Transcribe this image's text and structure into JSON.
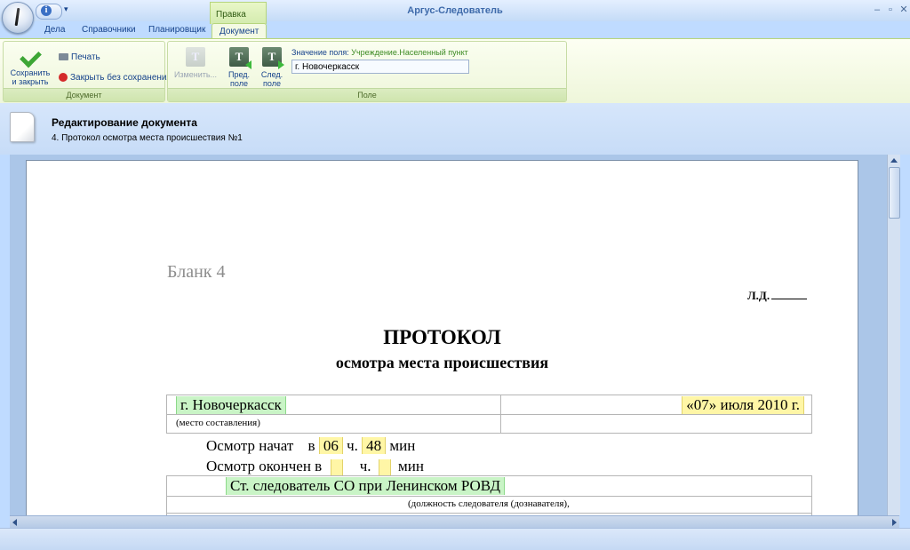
{
  "app": {
    "title": "Аргус-Следователь"
  },
  "ribbon_tabs": [
    {
      "label": "Дела"
    },
    {
      "label": "Справочники"
    },
    {
      "label": "Планировщик"
    },
    {
      "label": "Документ",
      "active": true
    }
  ],
  "contextual_group": {
    "label": "Правка"
  },
  "groups": {
    "document": {
      "label": "Документ",
      "save_line1": "Сохранить",
      "save_line2": "и закрыть",
      "print": "Печать",
      "close_no_save": "Закрыть без сохранения"
    },
    "field": {
      "label": "Поле",
      "change": "Изменить...",
      "prev_line1": "Пред.",
      "prev_line2": "поле",
      "next_line1": "След.",
      "next_line2": "поле",
      "value_caption": "Значение поля:",
      "value_path": "Учреждение.Населенный пункт",
      "value": "г. Новочеркасск"
    }
  },
  "doc_header": {
    "title": "Редактирование документа",
    "subtitle": "4. Протокол осмотра места происшествия №1"
  },
  "document": {
    "blank": "Бланк 4",
    "ld": "Л.Д.",
    "title": "ПРОТОКОЛ",
    "subtitle": "осмотра места происшествия",
    "place": "г. Новочеркасск",
    "place_hint": "(место составления)",
    "date": "«07» июля 2010 г.",
    "start_label": "Осмотр начат",
    "in": "в",
    "h": "ч.",
    "min": "мин",
    "start_hour": "06",
    "start_min": "48",
    "end_label": "Осмотр окончен в",
    "investigator": "Ст. следователь СО при Ленинском РОВД",
    "investigator_hint": "(должность следователя (дознавателя),"
  },
  "colors": {
    "ribbon_accent": "#b6d57d",
    "field_green": "#c9f4c6",
    "field_yellow": "#fff6a6",
    "title_blue": "#3e6aaa"
  }
}
